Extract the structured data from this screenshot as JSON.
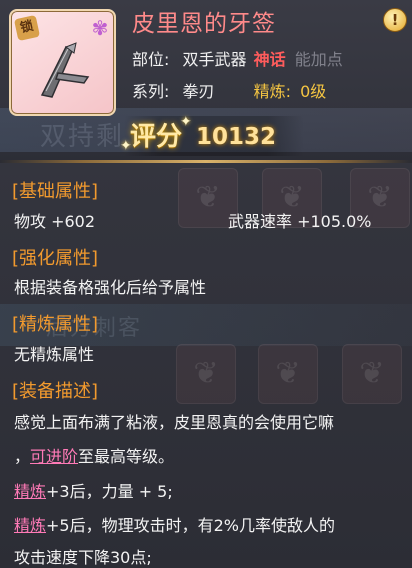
{
  "item": {
    "title": "皮里恩的牙签",
    "badge_icon": "lock-badge-icon",
    "rarity_icon": "lotus-icon"
  },
  "info": {
    "slot_label": "部位:",
    "slot_value": "双手武器",
    "rarity": "神话",
    "faded_text": "能加点",
    "series_label": "系列:",
    "series_value": "拳刃",
    "refine_label": "精炼:",
    "refine_value": "0级"
  },
  "background": {
    "ghost_band_1": "双持剩",
    "ghost_band_2": "后方刺客"
  },
  "score": {
    "label": "评分",
    "value": "10132"
  },
  "sections": {
    "base": {
      "title": "[基础属性]",
      "attack": "物攻 +602",
      "speed": "武器速率 +105.0%"
    },
    "enhance": {
      "title": "[强化属性]",
      "text": "根据装备格强化后给予属性"
    },
    "refine": {
      "title": "[精炼属性]",
      "text": "无精炼属性"
    },
    "desc": {
      "title": "[装备描述]",
      "line1": "感觉上面布满了粘液，皮里恩真的会使用它嘛",
      "line2_prefix": "，",
      "line2_link": "可进阶",
      "line2_suffix": "至最高等级。",
      "line3_link": "精炼",
      "line3_text": "+3后，力量 + 5;",
      "line4_link": "精炼",
      "line4_text": "+5后，物理攻击时，有2%几率使敌人的",
      "line5": "攻击速度下降30点;"
    }
  },
  "colors": {
    "title": "#ff8a8a",
    "section": "#f29a2e",
    "mythic": "#ff5c5c",
    "refine": "#f4c542",
    "link": "#ff7ab7",
    "score": "#ffe19a"
  }
}
